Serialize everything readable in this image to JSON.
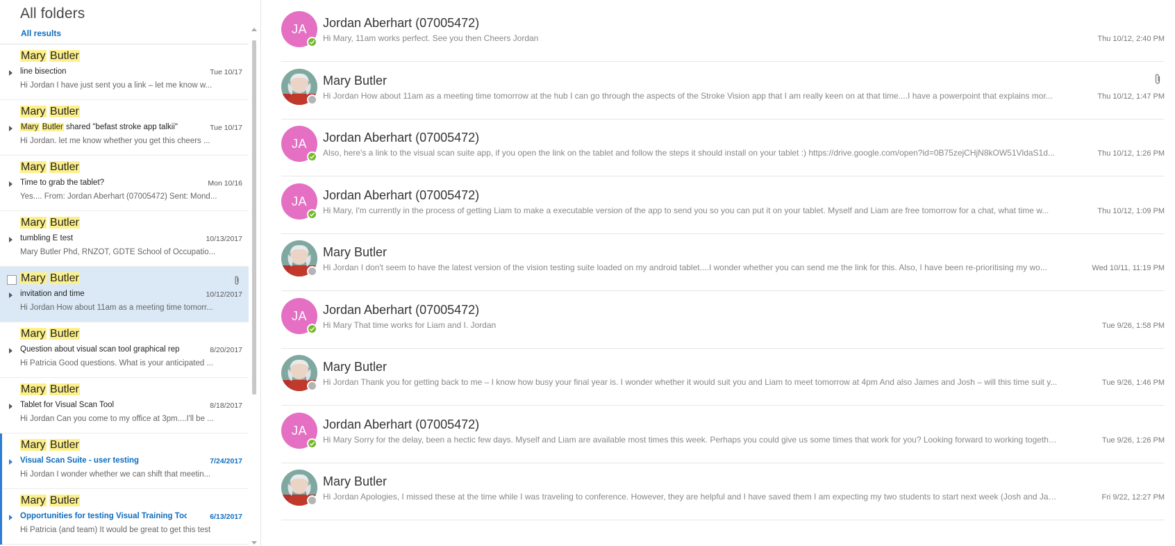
{
  "folder_pane": {
    "title": "All folders",
    "results_link": "All results"
  },
  "list": [
    {
      "sender_first": "Mary",
      "sender_last": "Butler",
      "subject": "line bisection",
      "date": "Tue 10/17",
      "preview": "Hi Jordan I have just sent you a link – let me know w...",
      "state": "normal"
    },
    {
      "sender_first": "Mary",
      "sender_last": "Butler",
      "subject_highlight_first": "Mary",
      "subject_highlight_last": "Butler",
      "subject": " shared \"befast stroke app talkii\" ",
      "date": "Tue 10/17",
      "preview": "Hi Jordan. let me know whether you get this cheers ...",
      "state": "normal"
    },
    {
      "sender_first": "Mary",
      "sender_last": "Butler",
      "subject": "Time to grab the tablet?",
      "date": "Mon 10/16",
      "preview": "Yes....  From: Jordan Aberhart (07005472) Sent: Mond...",
      "state": "normal"
    },
    {
      "sender_first": "Mary",
      "sender_last": "Butler",
      "subject": "tumbling E test",
      "date": "10/13/2017",
      "preview": "Mary Butler Phd, RNZOT, GDTE  School of Occupatio...",
      "state": "normal"
    },
    {
      "sender_first": "Mary",
      "sender_last": "Butler",
      "subject": "invitation and time",
      "date": "10/12/2017",
      "preview": "Hi Jordan How about 11am as a meeting time tomorr...",
      "state": "selected",
      "attachment": true
    },
    {
      "sender_first": "Mary",
      "sender_last": "Butler",
      "subject": "Question about visual scan tool graphical rep",
      "date": "8/20/2017",
      "preview": "Hi Patricia Good questions. What is your anticipated ...",
      "state": "normal"
    },
    {
      "sender_first": "Mary",
      "sender_last": "Butler",
      "subject": "Tablet for Visual Scan Tool",
      "date": "8/18/2017",
      "preview": "Hi Jordan Can you come to my office at 3pm....I'll be ...",
      "state": "normal"
    },
    {
      "sender_first": "Mary",
      "sender_last": "Butler",
      "subject": "Visual Scan Suite - user testing",
      "date": "7/24/2017",
      "preview": "Hi Jordan I wonder whether we can shift that meetin...",
      "state": "unread"
    },
    {
      "sender_first": "Mary",
      "sender_last": "Butler",
      "subject": "Opportunities for testing Visual Training Toc",
      "date": "6/13/2017",
      "preview": "Hi Patricia (and team)  It would be great to get this test",
      "state": "unread"
    }
  ],
  "conversation": [
    {
      "sender": "Jordan Aberhart (07005472)",
      "initials": "JA",
      "avatar": "initials",
      "presence": "online",
      "preview": "Hi Mary, 11am works perfect. See you then Cheers Jordan",
      "date": "Thu 10/12, 2:40 PM"
    },
    {
      "sender": "Mary Butler",
      "avatar": "photo",
      "presence": "offline",
      "preview": "Hi Jordan How about 11am as a meeting time tomorrow at the hub I can go through the aspects of the Stroke Vision app that I am really keen on at that time....I have a powerpoint that explains mor...",
      "date": "Thu 10/12, 1:47 PM",
      "attachment": true
    },
    {
      "sender": "Jordan Aberhart (07005472)",
      "initials": "JA",
      "avatar": "initials",
      "presence": "online",
      "preview": "Also, here's a link to the visual scan suite app, if you open the link on the tablet and follow the steps it should install on your tablet :) https://drive.google.com/open?id=0B75zejCHjN8kOW51VldaS1d...",
      "date": "Thu 10/12, 1:26 PM"
    },
    {
      "sender": "Jordan Aberhart (07005472)",
      "initials": "JA",
      "avatar": "initials",
      "presence": "online",
      "preview": "Hi Mary, I'm currently in the process of getting Liam to make a executable version of the app to send you so you can put it on your tablet. Myself and Liam are free tomorrow for a chat, what time w...",
      "date": "Thu 10/12, 1:09 PM"
    },
    {
      "sender": "Mary Butler",
      "avatar": "photo",
      "presence": "offline",
      "preview": "Hi Jordan I don't seem to have the latest version of the vision testing suite loaded on my android tablet....I wonder whether you can send me the link for this. Also, I have been re-prioritising my wo...",
      "date": "Wed 10/11, 11:19 PM"
    },
    {
      "sender": "Jordan Aberhart (07005472)",
      "initials": "JA",
      "avatar": "initials",
      "presence": "online",
      "preview": "Hi Mary That time works for Liam and I. Jordan",
      "date": "Tue 9/26, 1:58 PM"
    },
    {
      "sender": "Mary Butler",
      "avatar": "photo",
      "presence": "offline",
      "preview": "Hi Jordan Thank you for getting back to me – I know how busy your final year is. I wonder whether it would suit you and Liam to meet tomorrow at 4pm And also James and Josh – will this time suit y...",
      "date": "Tue 9/26, 1:46 PM"
    },
    {
      "sender": "Jordan Aberhart (07005472)",
      "initials": "JA",
      "avatar": "initials",
      "presence": "online",
      "preview": "Hi Mary Sorry for the delay, been a hectic few days. Myself and Liam are available most times this week. Perhaps you could give us some times that work for you? Looking forward to working together...",
      "date": "Tue 9/26, 1:26 PM"
    },
    {
      "sender": "Mary Butler",
      "avatar": "photo",
      "presence": "offline",
      "preview": "Hi Jordan Apologies, I missed these at the time while I was traveling to conference. However, they are helpful and I have saved them I am expecting my two students to start next week (Josh and Jame...",
      "date": "Fri 9/22, 12:27 PM"
    }
  ],
  "colors": {
    "accent": "#0f6cbd",
    "highlight": "#fdf08a",
    "selected_bg": "#dbe9f6",
    "avatar_pink": "#e46fc3",
    "presence_online": "#76b82a",
    "presence_offline": "#b4b4b4"
  }
}
